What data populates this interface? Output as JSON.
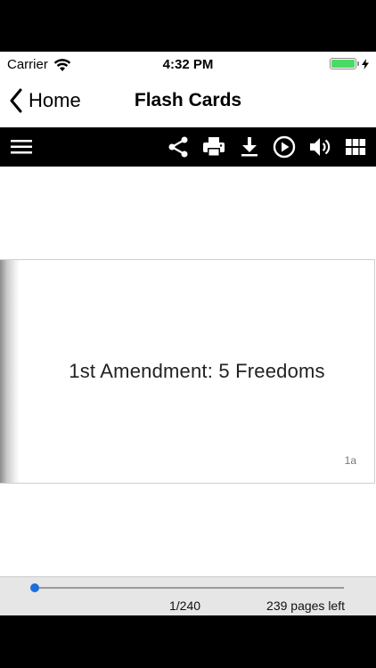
{
  "status_bar": {
    "carrier": "Carrier",
    "time": "4:32 PM",
    "battery_color": "#4cd964"
  },
  "nav_bar": {
    "back_label": "Home",
    "title": "Flash Cards"
  },
  "toolbar": {
    "icons": [
      "menu-icon",
      "share-icon",
      "print-icon",
      "download-icon",
      "play-icon",
      "volume-icon",
      "grid-icon"
    ]
  },
  "card": {
    "text": "1st Amendment: 5 Freedoms",
    "page_label": "1a"
  },
  "bottom_bar": {
    "page_counter": "1/240",
    "pages_left": "239 pages left",
    "slider_fraction": 0.0,
    "accent_color": "#1e6ee0"
  }
}
